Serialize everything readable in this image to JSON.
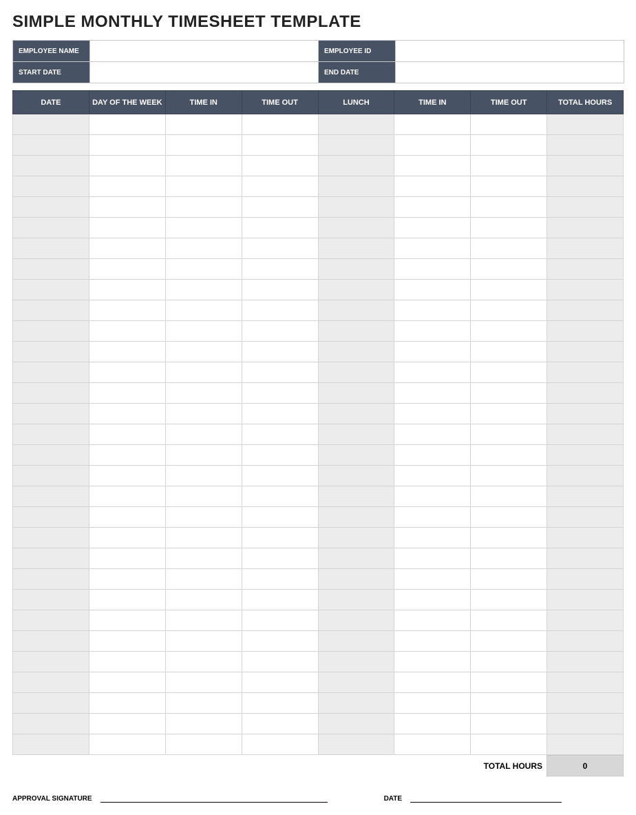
{
  "title": "SIMPLE MONTHLY TIMESHEET TEMPLATE",
  "info": {
    "employee_name_label": "EMPLOYEE NAME",
    "employee_name_value": "",
    "employee_id_label": "EMPLOYEE ID",
    "employee_id_value": "",
    "start_date_label": "START DATE",
    "start_date_value": "",
    "end_date_label": "END DATE",
    "end_date_value": ""
  },
  "columns": [
    "DATE",
    "DAY OF THE WEEK",
    "TIME IN",
    "TIME OUT",
    "LUNCH",
    "TIME IN",
    "TIME OUT",
    "TOTAL HOURS"
  ],
  "rows": [
    {
      "date": "",
      "day": "",
      "time_in_am": "",
      "time_out_am": "",
      "lunch": "",
      "time_in_pm": "",
      "time_out_pm": "",
      "total": ""
    },
    {
      "date": "",
      "day": "",
      "time_in_am": "",
      "time_out_am": "",
      "lunch": "",
      "time_in_pm": "",
      "time_out_pm": "",
      "total": ""
    },
    {
      "date": "",
      "day": "",
      "time_in_am": "",
      "time_out_am": "",
      "lunch": "",
      "time_in_pm": "",
      "time_out_pm": "",
      "total": ""
    },
    {
      "date": "",
      "day": "",
      "time_in_am": "",
      "time_out_am": "",
      "lunch": "",
      "time_in_pm": "",
      "time_out_pm": "",
      "total": ""
    },
    {
      "date": "",
      "day": "",
      "time_in_am": "",
      "time_out_am": "",
      "lunch": "",
      "time_in_pm": "",
      "time_out_pm": "",
      "total": ""
    },
    {
      "date": "",
      "day": "",
      "time_in_am": "",
      "time_out_am": "",
      "lunch": "",
      "time_in_pm": "",
      "time_out_pm": "",
      "total": ""
    },
    {
      "date": "",
      "day": "",
      "time_in_am": "",
      "time_out_am": "",
      "lunch": "",
      "time_in_pm": "",
      "time_out_pm": "",
      "total": ""
    },
    {
      "date": "",
      "day": "",
      "time_in_am": "",
      "time_out_am": "",
      "lunch": "",
      "time_in_pm": "",
      "time_out_pm": "",
      "total": ""
    },
    {
      "date": "",
      "day": "",
      "time_in_am": "",
      "time_out_am": "",
      "lunch": "",
      "time_in_pm": "",
      "time_out_pm": "",
      "total": ""
    },
    {
      "date": "",
      "day": "",
      "time_in_am": "",
      "time_out_am": "",
      "lunch": "",
      "time_in_pm": "",
      "time_out_pm": "",
      "total": ""
    },
    {
      "date": "",
      "day": "",
      "time_in_am": "",
      "time_out_am": "",
      "lunch": "",
      "time_in_pm": "",
      "time_out_pm": "",
      "total": ""
    },
    {
      "date": "",
      "day": "",
      "time_in_am": "",
      "time_out_am": "",
      "lunch": "",
      "time_in_pm": "",
      "time_out_pm": "",
      "total": ""
    },
    {
      "date": "",
      "day": "",
      "time_in_am": "",
      "time_out_am": "",
      "lunch": "",
      "time_in_pm": "",
      "time_out_pm": "",
      "total": ""
    },
    {
      "date": "",
      "day": "",
      "time_in_am": "",
      "time_out_am": "",
      "lunch": "",
      "time_in_pm": "",
      "time_out_pm": "",
      "total": ""
    },
    {
      "date": "",
      "day": "",
      "time_in_am": "",
      "time_out_am": "",
      "lunch": "",
      "time_in_pm": "",
      "time_out_pm": "",
      "total": ""
    },
    {
      "date": "",
      "day": "",
      "time_in_am": "",
      "time_out_am": "",
      "lunch": "",
      "time_in_pm": "",
      "time_out_pm": "",
      "total": ""
    },
    {
      "date": "",
      "day": "",
      "time_in_am": "",
      "time_out_am": "",
      "lunch": "",
      "time_in_pm": "",
      "time_out_pm": "",
      "total": ""
    },
    {
      "date": "",
      "day": "",
      "time_in_am": "",
      "time_out_am": "",
      "lunch": "",
      "time_in_pm": "",
      "time_out_pm": "",
      "total": ""
    },
    {
      "date": "",
      "day": "",
      "time_in_am": "",
      "time_out_am": "",
      "lunch": "",
      "time_in_pm": "",
      "time_out_pm": "",
      "total": ""
    },
    {
      "date": "",
      "day": "",
      "time_in_am": "",
      "time_out_am": "",
      "lunch": "",
      "time_in_pm": "",
      "time_out_pm": "",
      "total": ""
    },
    {
      "date": "",
      "day": "",
      "time_in_am": "",
      "time_out_am": "",
      "lunch": "",
      "time_in_pm": "",
      "time_out_pm": "",
      "total": ""
    },
    {
      "date": "",
      "day": "",
      "time_in_am": "",
      "time_out_am": "",
      "lunch": "",
      "time_in_pm": "",
      "time_out_pm": "",
      "total": ""
    },
    {
      "date": "",
      "day": "",
      "time_in_am": "",
      "time_out_am": "",
      "lunch": "",
      "time_in_pm": "",
      "time_out_pm": "",
      "total": ""
    },
    {
      "date": "",
      "day": "",
      "time_in_am": "",
      "time_out_am": "",
      "lunch": "",
      "time_in_pm": "",
      "time_out_pm": "",
      "total": ""
    },
    {
      "date": "",
      "day": "",
      "time_in_am": "",
      "time_out_am": "",
      "lunch": "",
      "time_in_pm": "",
      "time_out_pm": "",
      "total": ""
    },
    {
      "date": "",
      "day": "",
      "time_in_am": "",
      "time_out_am": "",
      "lunch": "",
      "time_in_pm": "",
      "time_out_pm": "",
      "total": ""
    },
    {
      "date": "",
      "day": "",
      "time_in_am": "",
      "time_out_am": "",
      "lunch": "",
      "time_in_pm": "",
      "time_out_pm": "",
      "total": ""
    },
    {
      "date": "",
      "day": "",
      "time_in_am": "",
      "time_out_am": "",
      "lunch": "",
      "time_in_pm": "",
      "time_out_pm": "",
      "total": ""
    },
    {
      "date": "",
      "day": "",
      "time_in_am": "",
      "time_out_am": "",
      "lunch": "",
      "time_in_pm": "",
      "time_out_pm": "",
      "total": ""
    },
    {
      "date": "",
      "day": "",
      "time_in_am": "",
      "time_out_am": "",
      "lunch": "",
      "time_in_pm": "",
      "time_out_pm": "",
      "total": ""
    },
    {
      "date": "",
      "day": "",
      "time_in_am": "",
      "time_out_am": "",
      "lunch": "",
      "time_in_pm": "",
      "time_out_pm": "",
      "total": ""
    }
  ],
  "footer": {
    "total_hours_label": "TOTAL HOURS",
    "total_hours_value": "0"
  },
  "signature": {
    "approval_label": "APPROVAL SIGNATURE",
    "date_label": "DATE"
  }
}
